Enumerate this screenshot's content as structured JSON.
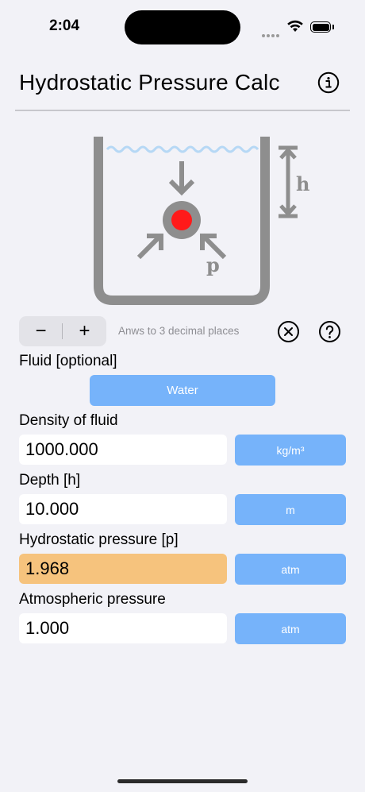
{
  "status": {
    "time": "2:04"
  },
  "header": {
    "title": "Hydrostatic Pressure Calc",
    "info_icon": "info-circle-icon"
  },
  "diagram": {
    "depth_label": "h",
    "pressure_label": "p",
    "colors": {
      "container": "#8e8e8e",
      "water": "#b6d8f5",
      "object": "#ff1a1a"
    }
  },
  "controls": {
    "minus_label": "−",
    "plus_label": "+",
    "decimal_text": "Anws to 3 decimal places",
    "clear_icon": "clear-circle-icon",
    "help_icon": "help-circle-icon"
  },
  "fluid": {
    "label": "Fluid [optional]",
    "button": "Water"
  },
  "fields": {
    "density": {
      "label": "Density of fluid",
      "value": "1000.000",
      "unit": "kg/m³"
    },
    "depth": {
      "label": "Depth [h]",
      "value": "10.000",
      "unit": "m"
    },
    "pressure": {
      "label": "Hydrostatic pressure [p]",
      "value": "1.968",
      "unit": "atm"
    },
    "atmospheric": {
      "label": "Atmospheric pressure",
      "value": "1.000",
      "unit": "atm"
    }
  },
  "colors": {
    "accent": "#76b3fa",
    "result": "#f6c37d",
    "background": "#f2f2f7"
  }
}
